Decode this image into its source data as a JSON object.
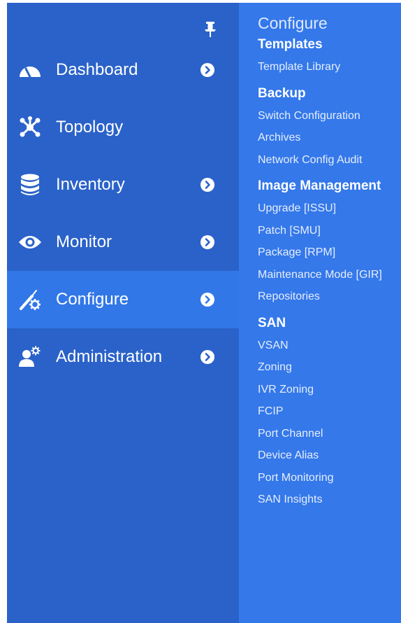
{
  "nav": {
    "items": [
      {
        "label": "Dashboard",
        "icon": "dashboard-gauge-icon",
        "has_submenu": true,
        "active": false
      },
      {
        "label": "Topology",
        "icon": "topology-icon",
        "has_submenu": false,
        "active": false
      },
      {
        "label": "Inventory",
        "icon": "database-icon",
        "has_submenu": true,
        "active": false
      },
      {
        "label": "Monitor",
        "icon": "eye-icon",
        "has_submenu": true,
        "active": false
      },
      {
        "label": "Configure",
        "icon": "wrench-gear-icon",
        "has_submenu": true,
        "active": true
      },
      {
        "label": "Administration",
        "icon": "user-gear-icon",
        "has_submenu": true,
        "active": false
      }
    ]
  },
  "panel": {
    "title": "Configure",
    "sections": [
      {
        "heading": "Templates",
        "items": [
          "Template Library"
        ]
      },
      {
        "heading": "Backup",
        "items": [
          "Switch Configuration",
          "Archives",
          "Network Config Audit"
        ]
      },
      {
        "heading": "Image Management",
        "items": [
          "Upgrade [ISSU]",
          "Patch [SMU]",
          "Package [RPM]",
          "Maintenance Mode [GIR]",
          "Repositories"
        ]
      },
      {
        "heading": "SAN",
        "items": [
          "VSAN",
          "Zoning",
          "IVR Zoning",
          "FCIP",
          "Port Channel",
          "Device Alias",
          "Port Monitoring",
          "SAN Insights"
        ]
      }
    ]
  },
  "colors": {
    "nav_bg": "#2a62c9",
    "nav_active_bg": "#3177e8",
    "panel_bg": "#3478ea",
    "text": "#ffffff"
  }
}
